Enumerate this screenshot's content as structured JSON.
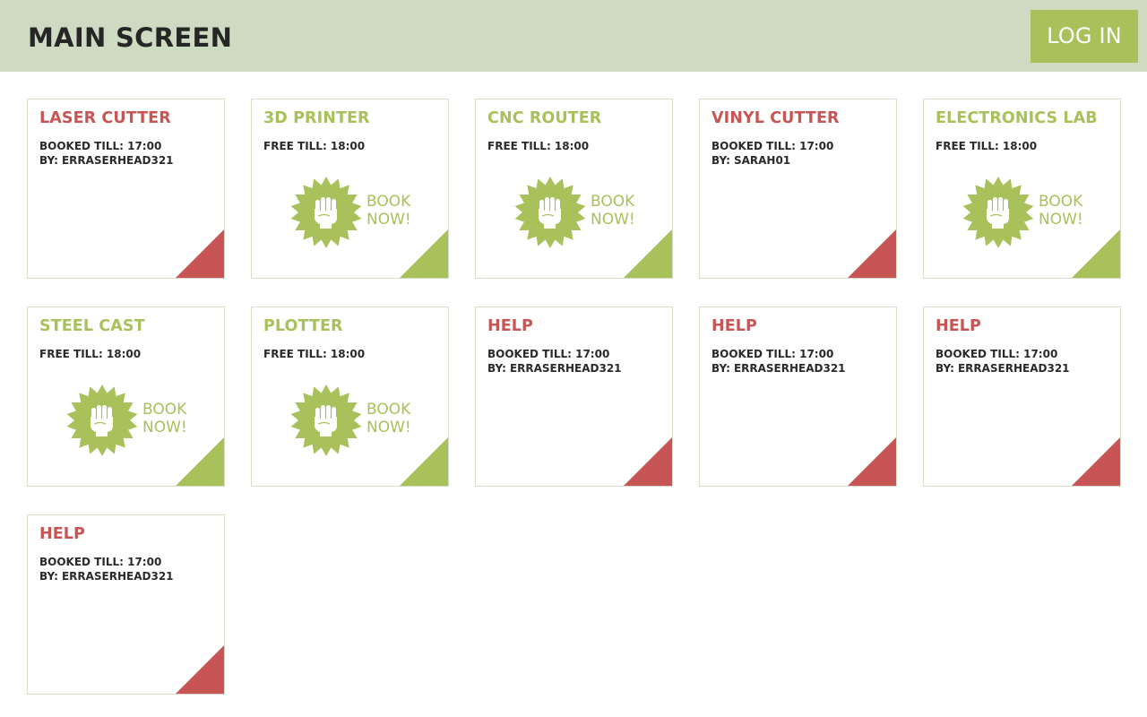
{
  "header": {
    "title": "MAIN SCREEN",
    "login_label": "LOG IN"
  },
  "colors": {
    "header_bg": "#cedbc2",
    "accent_green": "#a8c15b",
    "booked_red": "#c85555",
    "card_border": "#d7ddca"
  },
  "book_now": {
    "line1": "BOOK",
    "line2": "NOW!",
    "icon": "fist-seal-icon"
  },
  "cards": [
    {
      "name": "LASER CUTTER",
      "status": "booked",
      "line1": "BOOKED TILL: 17:00",
      "by_label": "BY:",
      "by": "ERRASERHEAD321"
    },
    {
      "name": "3D PRINTER",
      "status": "free",
      "line1": "FREE TILL: 18:00"
    },
    {
      "name": "CNC ROUTER",
      "status": "free",
      "line1": "FREE TILL: 18:00"
    },
    {
      "name": "VINYL CUTTER",
      "status": "booked",
      "line1": "BOOKED TILL: 17:00",
      "by_label": "BY:",
      "by": "SARAH01"
    },
    {
      "name": "ELECTRONICS LAB",
      "status": "free",
      "line1": "FREE TILL: 18:00"
    },
    {
      "name": "STEEL CAST",
      "status": "free",
      "line1": "FREE TILL: 18:00"
    },
    {
      "name": "PLOTTER",
      "status": "free",
      "line1": "FREE TILL: 18:00"
    },
    {
      "name": "HELP",
      "status": "booked",
      "line1": "BOOKED TILL: 17:00",
      "by_label": "BY:",
      "by": "ERRASERHEAD321"
    },
    {
      "name": "HELP",
      "status": "booked",
      "line1": "BOOKED TILL: 17:00",
      "by_label": "BY:",
      "by": "ERRASERHEAD321"
    },
    {
      "name": "HELP",
      "status": "booked",
      "line1": "BOOKED TILL: 17:00",
      "by_label": "BY:",
      "by": "ERRASERHEAD321"
    },
    {
      "name": "HELP",
      "status": "booked",
      "line1": "BOOKED TILL: 17:00",
      "by_label": "BY:",
      "by": "ERRASERHEAD321"
    }
  ]
}
